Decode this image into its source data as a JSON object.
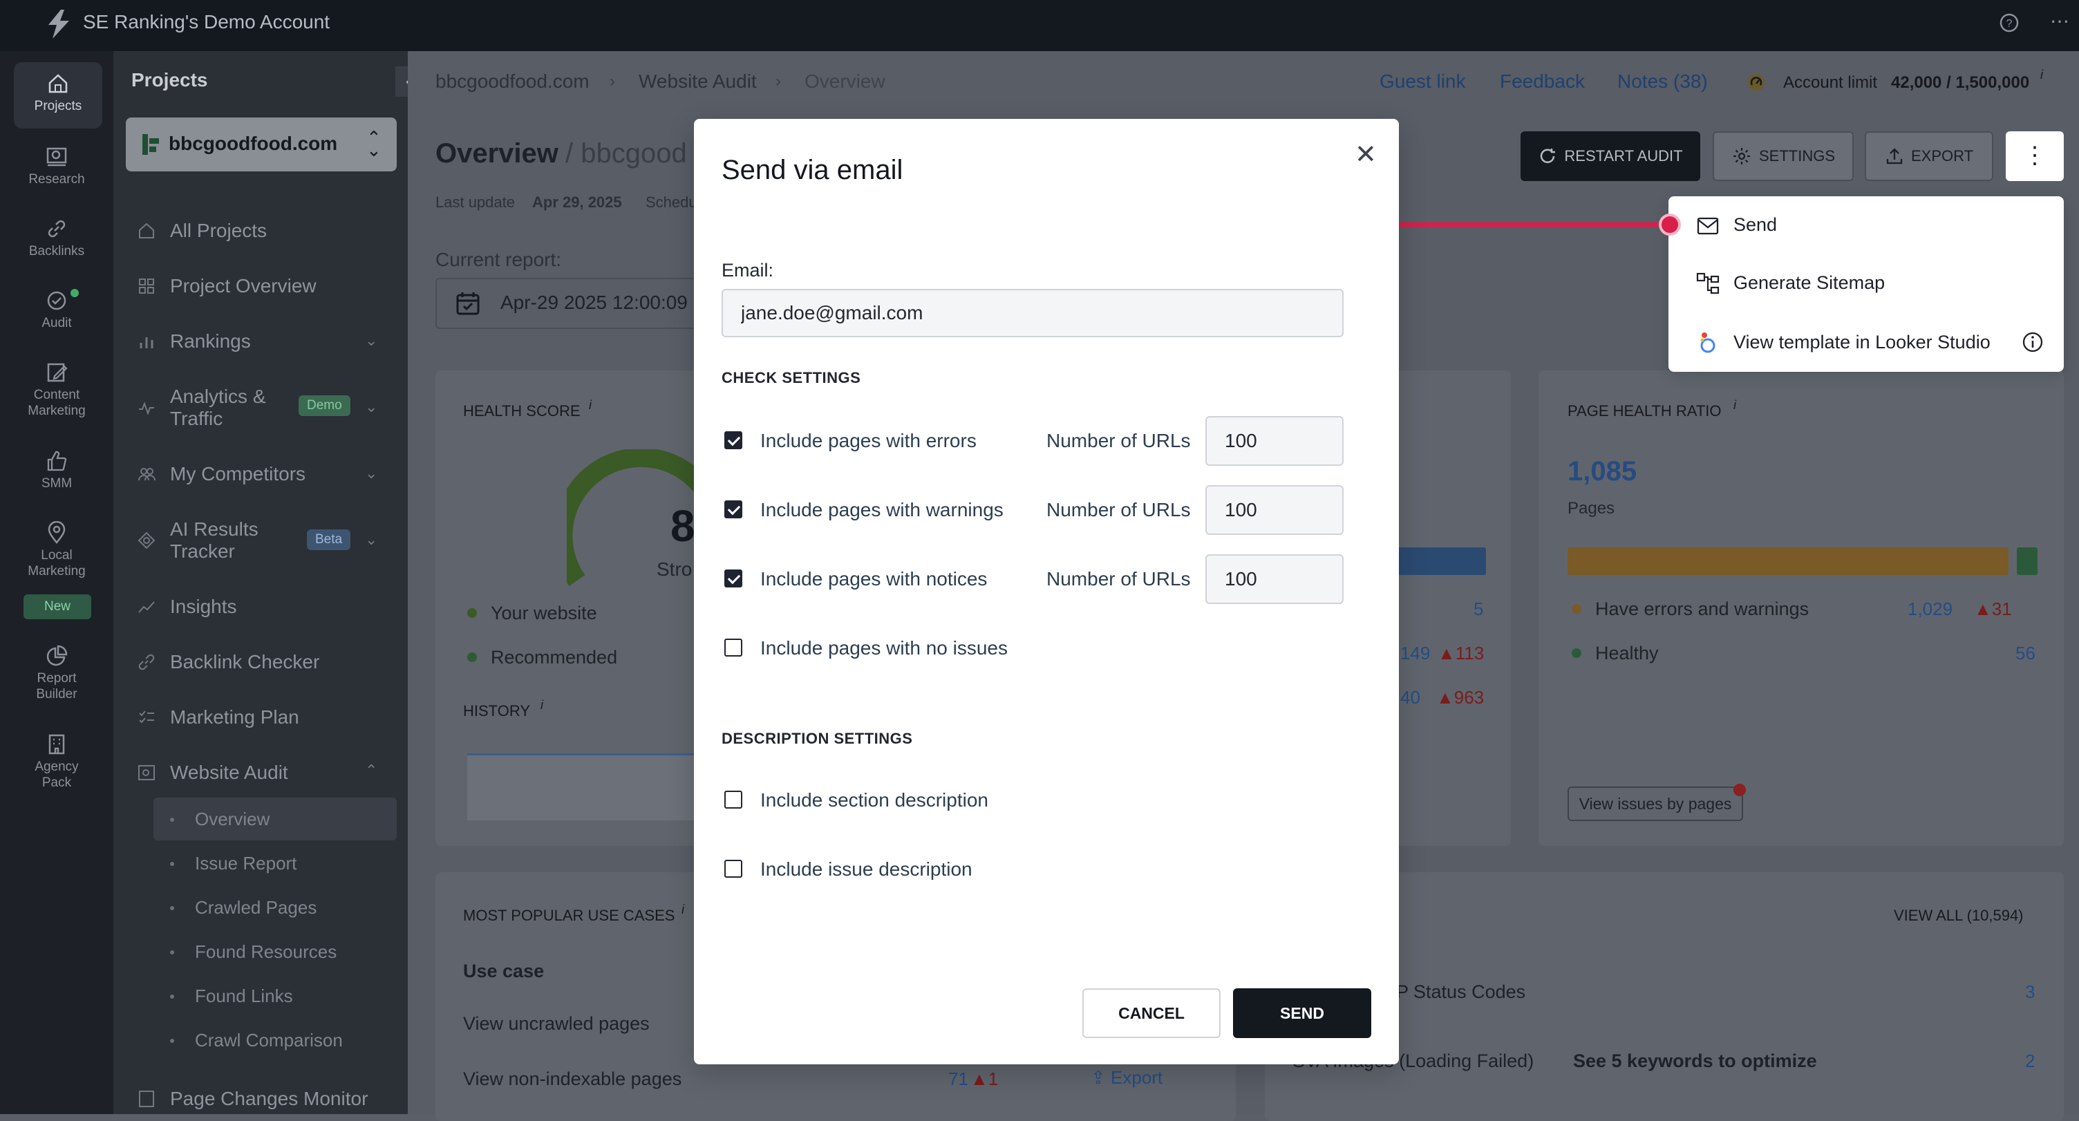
{
  "titlebar": {
    "title": "SE Ranking's Demo Account",
    "help_icon": "help-circle-icon",
    "more_icon": "ellipsis-icon"
  },
  "rail": {
    "items": [
      {
        "label": "Projects",
        "icon": "home-icon"
      },
      {
        "label": "Research",
        "icon": "research-icon"
      },
      {
        "label": "Backlinks",
        "icon": "link-icon"
      },
      {
        "label": "Audit",
        "icon": "audit-icon"
      },
      {
        "label": "Content Marketing",
        "line1": "Content",
        "line2": "Marketing",
        "icon": "edit-icon"
      },
      {
        "label": "SMM",
        "icon": "thumbs-up-icon"
      },
      {
        "label": "Local Marketing",
        "line1": "Local",
        "line2": "Marketing",
        "icon": "location-pin-icon"
      },
      {
        "label": "Report Builder",
        "line1": "Report",
        "line2": "Builder",
        "icon": "pie-chart-icon"
      },
      {
        "label": "Agency Pack",
        "line1": "Agency",
        "line2": "Pack",
        "icon": "building-icon"
      }
    ],
    "new_badge": "New"
  },
  "sidebar": {
    "title": "Projects",
    "project": "bbcgoodfood.com",
    "items": [
      {
        "label": "All Projects"
      },
      {
        "label": "Project Overview"
      },
      {
        "label": "Rankings"
      },
      {
        "label": "Analytics &",
        "label2": "Traffic",
        "badge": "Demo"
      },
      {
        "label": "My Competitors"
      },
      {
        "label": "AI Results",
        "label2": "Tracker",
        "badge": "Beta"
      },
      {
        "label": "Insights"
      },
      {
        "label": "Backlink Checker"
      },
      {
        "label": "Marketing Plan"
      },
      {
        "label": "Website Audit"
      },
      {
        "label": "Page Changes Monitor"
      }
    ],
    "sub_items": [
      "Overview",
      "Issue Report",
      "Crawled Pages",
      "Found Resources",
      "Found Links",
      "Crawl Comparison"
    ]
  },
  "breadcrumb": [
    "bbcgoodfood.com",
    "Website Audit",
    "Overview"
  ],
  "toplinks": {
    "guest": "Guest link",
    "feedback": "Feedback",
    "notes": "Notes (38)",
    "account_label": "Account limit",
    "account_value": "42,000 / 1,500,000",
    "account_info": "i"
  },
  "page": {
    "title": "Overview",
    "title_suffix": "/ bbcgood",
    "last_update_label": "Last update",
    "last_update_value": "Apr 29, 2025",
    "schedule_text": "Schedu",
    "current_report_label": "Current report:",
    "current_report_value": "Apr-29 2025 12:00:09"
  },
  "header_buttons": {
    "restart": "RESTART AUDIT",
    "settings": "SETTINGS",
    "export": "EXPORT"
  },
  "health": {
    "label": "HEALTH SCORE",
    "info": "i",
    "score_partial": "8",
    "status_partial": "Stro",
    "legend": [
      "Your website",
      "Recommended"
    ],
    "history_label": "HISTORY"
  },
  "middle_card": {
    "value_a": "5",
    "value_b": "149",
    "value_b_delta": "113",
    "value_c": "40",
    "value_c_delta": "963"
  },
  "page_health": {
    "label": "PAGE HEALTH RATIO",
    "info": "i",
    "total": "1,085",
    "total_unit": "Pages",
    "rows": [
      {
        "label": "Have errors and warnings",
        "value": "1,029",
        "delta": "31"
      },
      {
        "label": "Healthy",
        "value": "56"
      }
    ],
    "button": "View issues by pages"
  },
  "use_cases": {
    "title": "MOST POPULAR USE CASES",
    "info": "i",
    "header": "Use case",
    "rows": [
      {
        "label": "View uncrawled pages"
      },
      {
        "label": "View non-indexable pages",
        "value": "71",
        "delta": "1",
        "action": "Export"
      }
    ]
  },
  "issues_card": {
    "view_all": "VIEW ALL (10,594)",
    "rows": [
      {
        "label": "P Status Codes",
        "value": "3"
      },
      {
        "label": "SVA Images (Loading Failed)",
        "extra": "See 5 keywords to optimize",
        "value": "2"
      }
    ]
  },
  "dropdown_menu": {
    "items": [
      {
        "label": "Send",
        "icon": "mail-icon"
      },
      {
        "label": "Generate Sitemap",
        "icon": "sitemap-icon"
      },
      {
        "label": "View template in Looker Studio",
        "icon": "looker-studio-icon"
      }
    ]
  },
  "modal": {
    "title": "Send via email",
    "email_label": "Email:",
    "email_value": "jane.doe@gmail.com",
    "check_settings_title": "CHECK SETTINGS",
    "checks": [
      {
        "label": "Include pages with errors",
        "checked": true,
        "url_label": "Number of URLs",
        "url_value": "100"
      },
      {
        "label": "Include pages with warnings",
        "checked": true,
        "url_label": "Number of URLs",
        "url_value": "100"
      },
      {
        "label": "Include pages with notices",
        "checked": true,
        "url_label": "Number of URLs",
        "url_value": "100"
      },
      {
        "label": "Include pages with no issues",
        "checked": false
      }
    ],
    "description_title": "DESCRIPTION SETTINGS",
    "descriptions": [
      {
        "label": "Include section description",
        "checked": false
      },
      {
        "label": "Include issue description",
        "checked": false
      }
    ],
    "cancel": "CANCEL",
    "send": "SEND"
  },
  "colors": {
    "accent_dark": "#14181f",
    "annotation_arrow": "#d81f4a",
    "link_blue": "#2f6fd6",
    "success_green": "#3fae65"
  }
}
